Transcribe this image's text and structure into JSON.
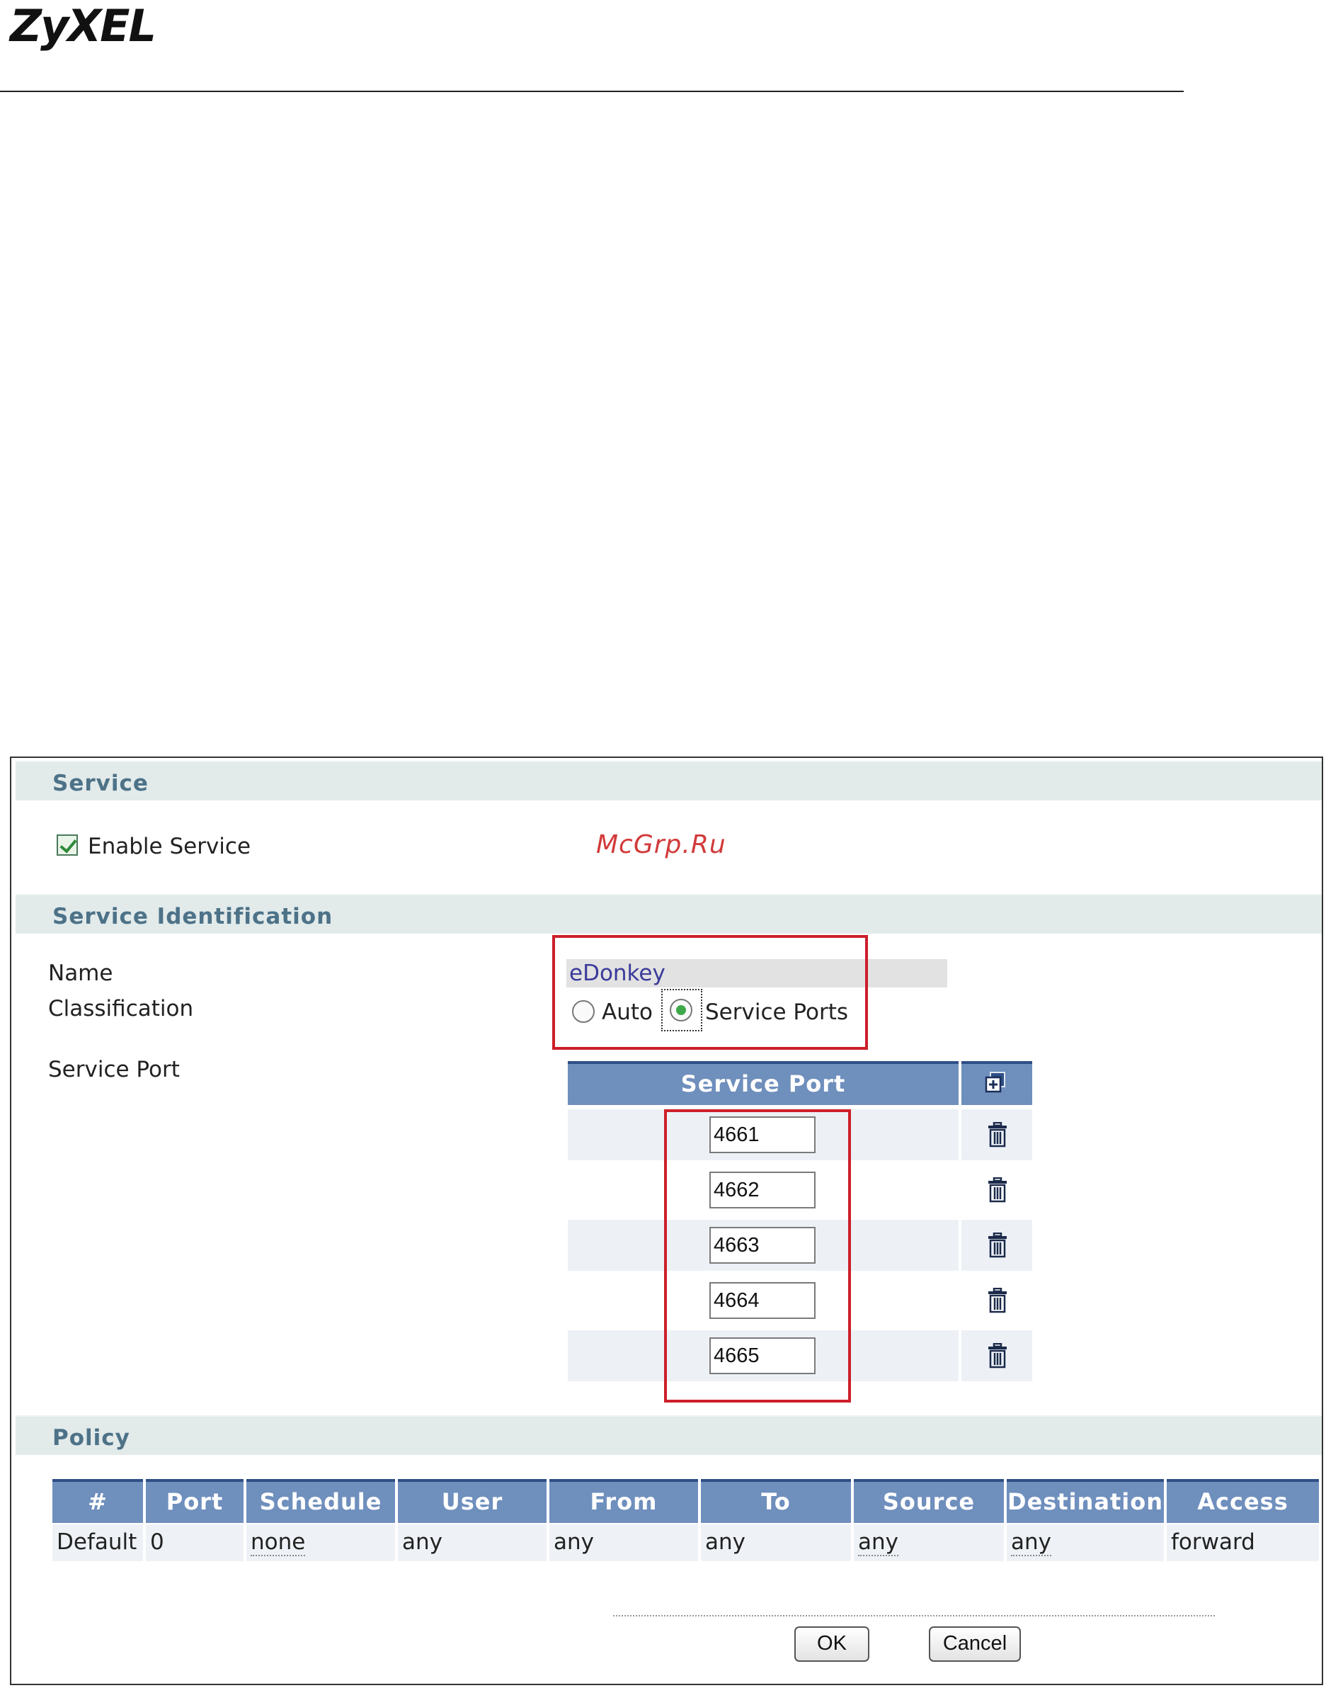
{
  "brand": {
    "logo_text": "ZyXEL"
  },
  "watermark": "McGrp.Ru",
  "service_section": {
    "title": "Service",
    "enable_label": "Enable Service",
    "enabled": true
  },
  "identification_section": {
    "title": "Service Identification",
    "name_label": "Name",
    "name_value": "eDonkey",
    "classification_label": "Classification",
    "classification_options": [
      "Auto",
      "Service Ports"
    ],
    "classification_selected": "Service Ports",
    "service_port_label": "Service Port"
  },
  "service_port_table": {
    "header": "Service Port",
    "add_icon": "add-icon",
    "delete_icon": "trash-icon",
    "ports": [
      "4661",
      "4662",
      "4663",
      "4664",
      "4665"
    ]
  },
  "policy_section": {
    "title": "Policy",
    "columns": [
      "#",
      "Port",
      "Schedule",
      "User",
      "From",
      "To",
      "Source",
      "Destination",
      "Access"
    ],
    "rows": [
      [
        "Default",
        "0",
        "none",
        "any",
        "any",
        "any",
        "any",
        "any",
        "forward"
      ]
    ]
  },
  "buttons": {
    "ok": "OK",
    "cancel": "Cancel"
  },
  "colors": {
    "section_bar": "#e2eaea",
    "section_title": "#4d7288",
    "table_header": "#6f8fbd",
    "highlight_box": "#cc1f2a"
  }
}
